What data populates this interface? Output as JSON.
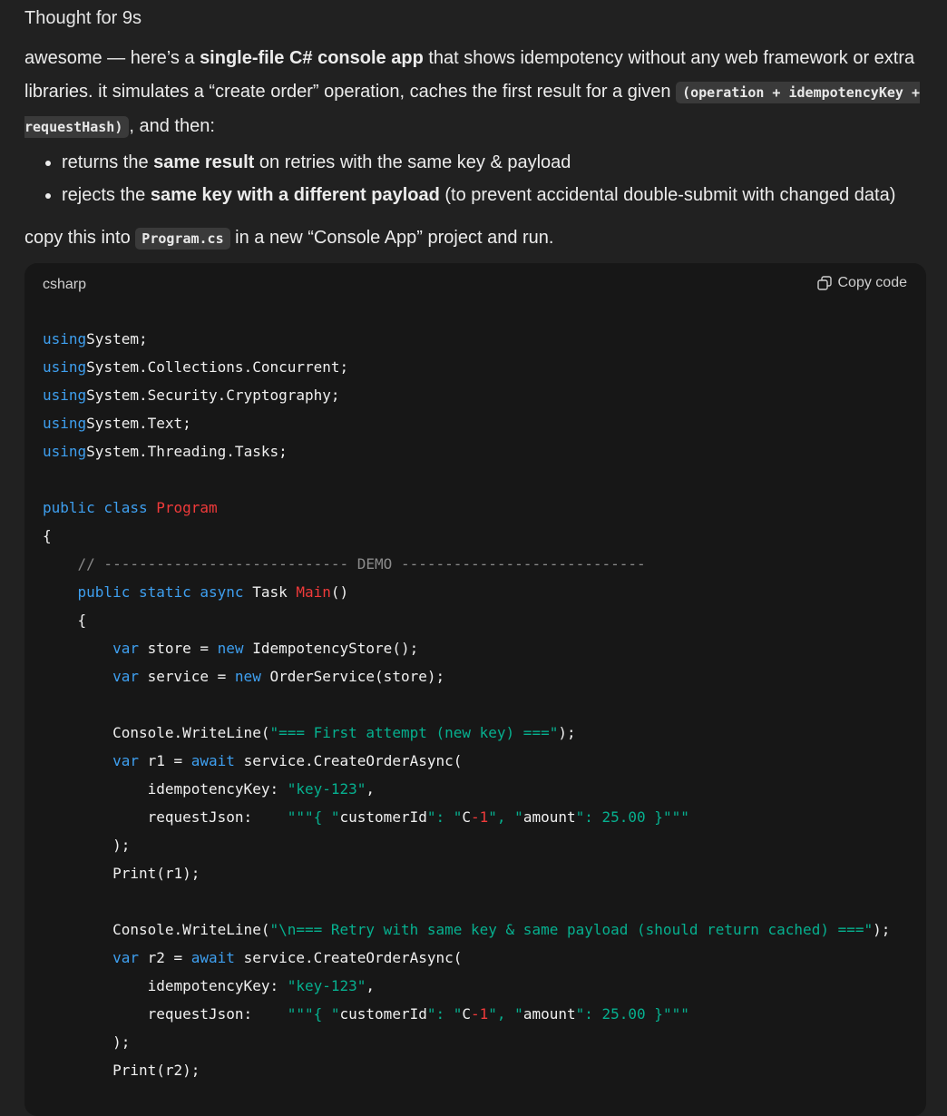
{
  "thought": "Thought for 9s",
  "intro": {
    "t1": "awesome — here’s a ",
    "b1": "single-file C# console app",
    "t2": " that shows idempotency without any web framework or extra libraries. it simulates a “create order” operation, caches the first result for a given ",
    "code1": "(operation + idempotencyKey + requestHash)",
    "t3": ", and then:"
  },
  "bullets": [
    {
      "t1": "returns the ",
      "b": "same result",
      "t2": " on retries with the same key & payload"
    },
    {
      "t1": "rejects the ",
      "b": "same key with a different payload",
      "t2": " (to prevent accidental double-submit with changed data)"
    }
  ],
  "instruction": {
    "t1": "copy this into ",
    "code": "Program.cs",
    "t2": " in a new “Console App” project and run."
  },
  "codeblock": {
    "language": "csharp",
    "copy_label": "Copy code",
    "lines": [
      [
        [
          "kw",
          "using"
        ],
        [
          "",
          "System;"
        ]
      ],
      [
        [
          "kw",
          "using"
        ],
        [
          "",
          "System.Collections.Concurrent;"
        ]
      ],
      [
        [
          "kw",
          "using"
        ],
        [
          "",
          "System.Security.Cryptography;"
        ]
      ],
      [
        [
          "kw",
          "using"
        ],
        [
          "",
          "System.Text;"
        ]
      ],
      [
        [
          "kw",
          "using"
        ],
        [
          "",
          "System.Threading.Tasks;"
        ]
      ],
      [],
      [
        [
          "kw",
          "public class "
        ],
        [
          "cls",
          "Program"
        ]
      ],
      [
        [
          "",
          "{"
        ]
      ],
      [
        [
          "com",
          "    // ---------------------------- DEMO ----------------------------"
        ]
      ],
      [
        [
          "kw",
          "    public static async "
        ],
        [
          "",
          "Task "
        ],
        [
          "cls",
          "Main"
        ],
        [
          "",
          "()"
        ]
      ],
      [
        [
          "",
          "    {"
        ]
      ],
      [
        [
          "kw",
          "        var "
        ],
        [
          "",
          "store = "
        ],
        [
          "kw",
          "new "
        ],
        [
          "",
          "IdempotencyStore();"
        ]
      ],
      [
        [
          "kw",
          "        var "
        ],
        [
          "",
          "service = "
        ],
        [
          "kw",
          "new "
        ],
        [
          "",
          "OrderService(store);"
        ]
      ],
      [],
      [
        [
          "",
          "        Console.WriteLine("
        ],
        [
          "str",
          "\"=== First attempt (new key) ===\""
        ],
        [
          "",
          ");"
        ]
      ],
      [
        [
          "kw",
          "        var "
        ],
        [
          "",
          "r1 = "
        ],
        [
          "kw",
          "await "
        ],
        [
          "",
          "service.CreateOrderAsync("
        ]
      ],
      [
        [
          "",
          "            idempotencyKey: "
        ],
        [
          "str",
          "\"key-123\""
        ],
        [
          "",
          ","
        ]
      ],
      [
        [
          "",
          "            requestJson:    "
        ],
        [
          "str",
          "\"\"\"{ \""
        ],
        [
          "",
          "customerId"
        ],
        [
          "str",
          "\": \""
        ],
        [
          "",
          "C"
        ],
        [
          "cls",
          "-1"
        ],
        [
          "str",
          "\", \""
        ],
        [
          "",
          "amount"
        ],
        [
          "str",
          "\": 25.00 }\"\"\""
        ]
      ],
      [
        [
          "",
          "        );"
        ]
      ],
      [
        [
          "",
          "        Print(r1);"
        ]
      ],
      [],
      [
        [
          "",
          "        Console.WriteLine("
        ],
        [
          "str",
          "\"\\n=== Retry with same key & same payload (should return cached) ===\""
        ],
        [
          "",
          ");"
        ]
      ],
      [
        [
          "kw",
          "        var "
        ],
        [
          "",
          "r2 = "
        ],
        [
          "kw",
          "await "
        ],
        [
          "",
          "service.CreateOrderAsync("
        ]
      ],
      [
        [
          "",
          "            idempotencyKey: "
        ],
        [
          "str",
          "\"key-123\""
        ],
        [
          "",
          ","
        ]
      ],
      [
        [
          "",
          "            requestJson:    "
        ],
        [
          "str",
          "\"\"\"{ \""
        ],
        [
          "",
          "customerId"
        ],
        [
          "str",
          "\": \""
        ],
        [
          "",
          "C"
        ],
        [
          "cls",
          "-1"
        ],
        [
          "str",
          "\", \""
        ],
        [
          "",
          "amount"
        ],
        [
          "str",
          "\": 25.00 }\"\"\""
        ]
      ],
      [
        [
          "",
          "        );"
        ]
      ],
      [
        [
          "",
          "        Print(r2);"
        ]
      ]
    ]
  }
}
